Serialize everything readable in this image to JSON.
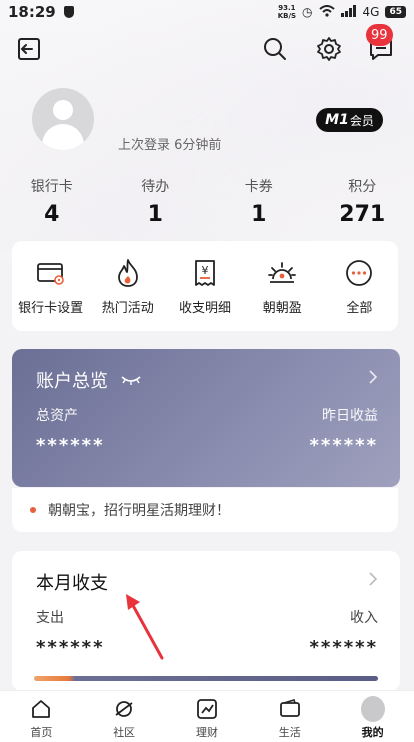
{
  "status_bar": {
    "time": "18:29",
    "net_speed": "93.1",
    "net_unit": "KB/S",
    "signal": "4G",
    "battery": "65"
  },
  "header": {
    "notification_badge": "99"
  },
  "profile": {
    "last_login": "上次登录 6分钟前",
    "member_prefix": "M1",
    "member_label": "会员"
  },
  "stats": [
    {
      "label": "银行卡",
      "value": "4"
    },
    {
      "label": "待办",
      "value": "1"
    },
    {
      "label": "卡券",
      "value": "1"
    },
    {
      "label": "积分",
      "value": "271"
    }
  ],
  "quick_menu": [
    {
      "label": "银行卡设置",
      "icon": "card-settings-icon"
    },
    {
      "label": "热门活动",
      "icon": "flame-icon"
    },
    {
      "label": "收支明细",
      "icon": "receipt-icon"
    },
    {
      "label": "朝朝盈",
      "icon": "sunrise-icon"
    },
    {
      "label": "全部",
      "icon": "more-icon"
    }
  ],
  "overview": {
    "title": "账户总览",
    "total_assets_label": "总资产",
    "yesterday_label": "昨日收益",
    "total_assets_value": "******",
    "yesterday_value": "******"
  },
  "promo": {
    "text": "朝朝宝，招行明星活期理财！"
  },
  "monthly": {
    "title": "本月收支",
    "expense_label": "支出",
    "income_label": "收入",
    "expense_value": "******",
    "income_value": "******"
  },
  "nav": [
    {
      "label": "首页",
      "icon": "home-icon"
    },
    {
      "label": "社区",
      "icon": "planet-icon"
    },
    {
      "label": "理财",
      "icon": "trend-icon"
    },
    {
      "label": "生活",
      "icon": "wallet-icon"
    },
    {
      "label": "我的",
      "icon": "avatar"
    }
  ],
  "colors": {
    "accent_red": "#e8333c",
    "overview_bg": "#7a7ea2",
    "promo_dot": "#e5603b"
  }
}
